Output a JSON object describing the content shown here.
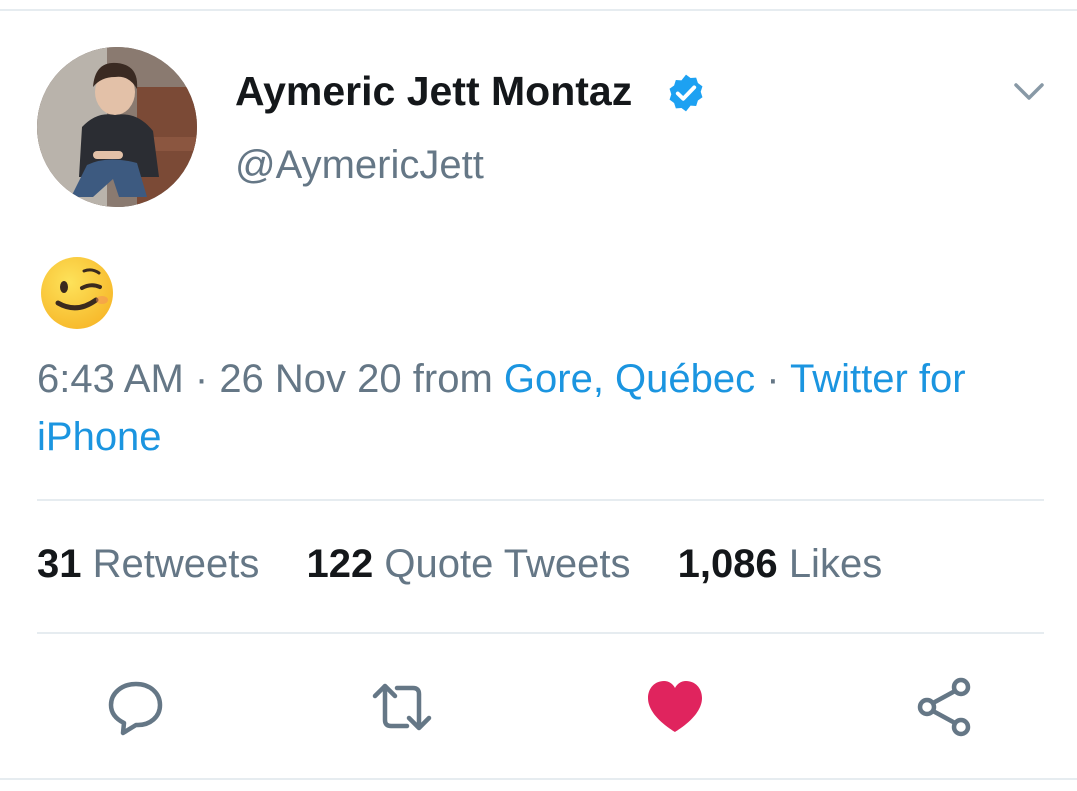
{
  "tweet": {
    "author": {
      "display_name": "Aymeric Jett Montaz",
      "handle": "@AymericJett",
      "verified": true,
      "avatar_icon": "profile-photo"
    },
    "content_emoji": "winking-face-emoji",
    "meta": {
      "time": "6:43 AM",
      "separator": " · ",
      "date": "26 Nov 20",
      "from_text": " from ",
      "location": "Gore, Québec",
      "separator2": " · ",
      "source": "Twitter for iPhone"
    },
    "stats": [
      {
        "count": "31",
        "label": "Retweets"
      },
      {
        "count": "122",
        "label": "Quote Tweets"
      },
      {
        "count": "1,086",
        "label": "Likes"
      }
    ],
    "actions": {
      "reply_icon": "reply-icon",
      "retweet_icon": "retweet-icon",
      "like_icon": "heart-icon",
      "share_icon": "share-icon",
      "liked": true
    }
  },
  "colors": {
    "text_primary": "#14171a",
    "text_secondary": "#657786",
    "link": "#1b95e0",
    "verified": "#1da1f2",
    "like": "#e0245e",
    "divider": "#e6ecf0"
  }
}
